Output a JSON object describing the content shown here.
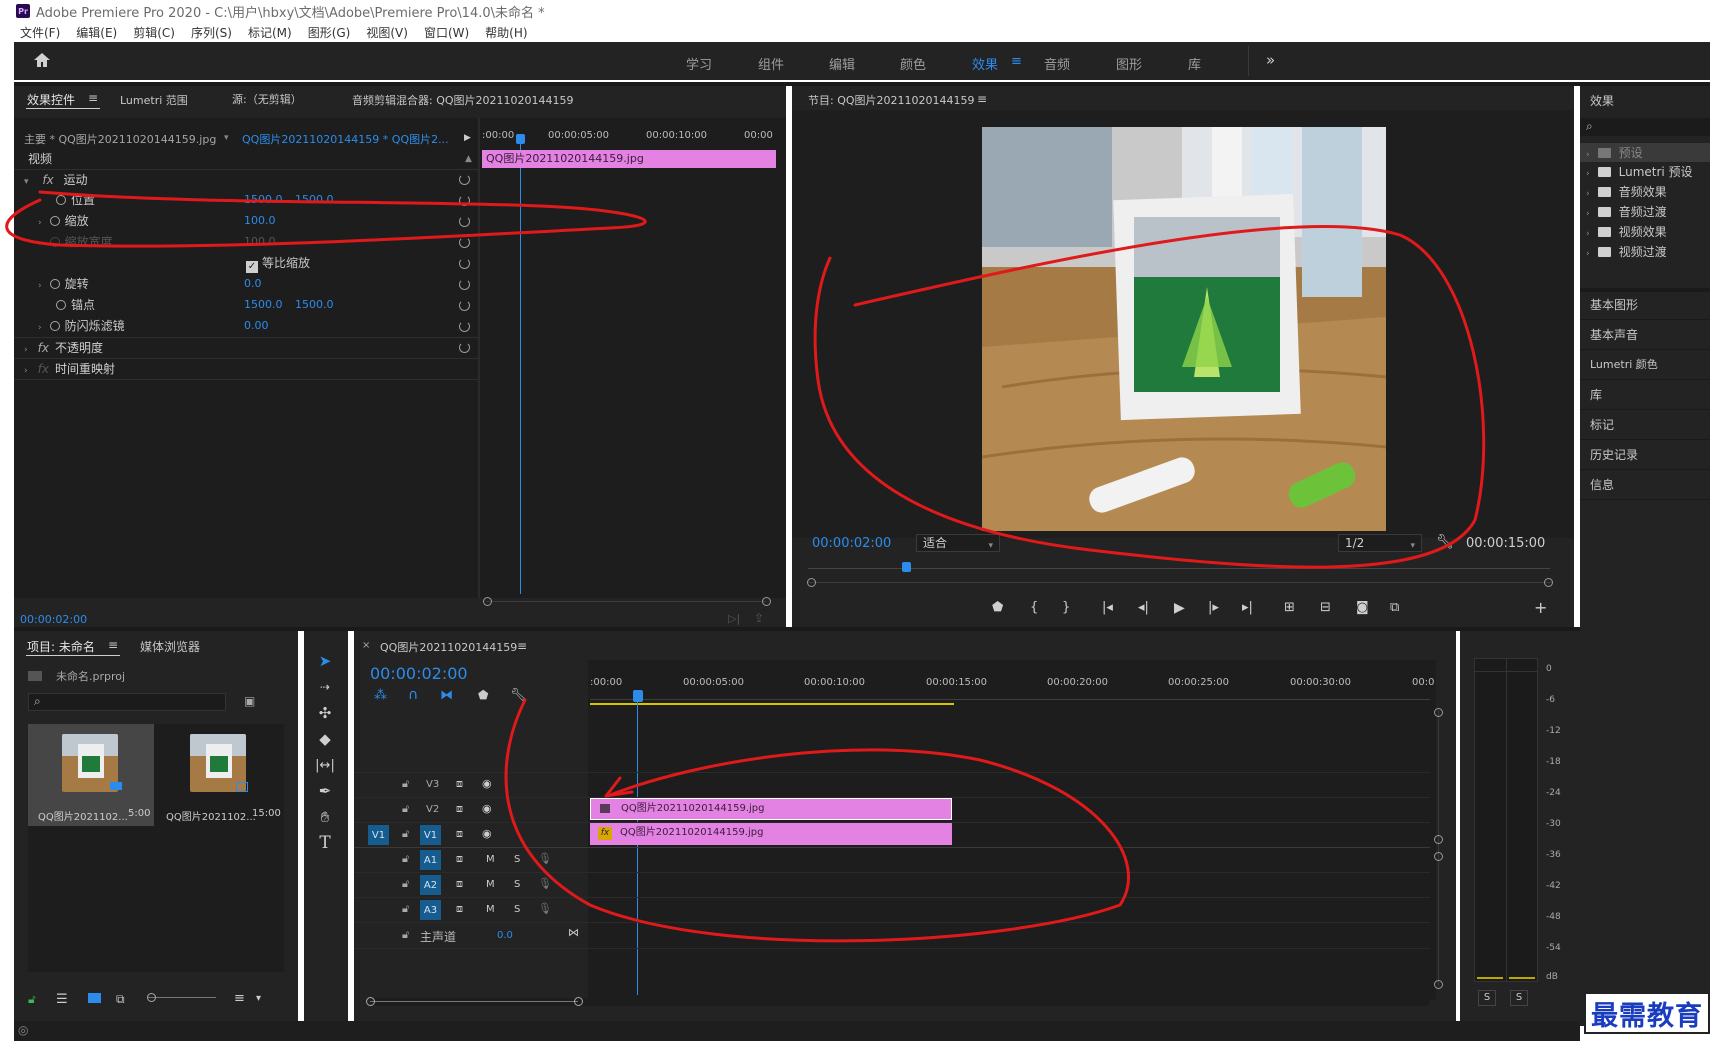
{
  "window": {
    "title": "Adobe Premiere Pro 2020 - C:\\用户\\hbxy\\文档\\Adobe\\Premiere Pro\\14.0\\未命名 *",
    "logo": "Pr"
  },
  "menu": [
    "文件(F)",
    "编辑(E)",
    "剪辑(C)",
    "序列(S)",
    "标记(M)",
    "图形(G)",
    "视图(V)",
    "窗口(W)",
    "帮助(H)"
  ],
  "workspaces": [
    "学习",
    "组件",
    "编辑",
    "颜色",
    "效果",
    "音频",
    "图形",
    "库"
  ],
  "workspace_more": "»",
  "effect_controls": {
    "tabs": [
      "效果控件",
      "Lumetri 范围",
      "源:（无剪辑）",
      "音频剪辑混合器: QQ图片20211020144159"
    ],
    "master_label": "主要 * QQ图片20211020144159.jpg",
    "clip_label": "QQ图片20211020144159 * QQ图片2...",
    "ruler": [
      ":00:00",
      "00:00:05:00",
      "00:00:10:00",
      "00:00"
    ],
    "clip_name": "QQ图片20211020144159.jpg",
    "section_video": "视频",
    "motion": "运动",
    "position": {
      "label": "位置",
      "x": "1500.0",
      "y": "1500.0"
    },
    "scale": {
      "label": "缩放",
      "value": "100.0"
    },
    "scale_width": {
      "label": "缩放宽度",
      "value": "100.0"
    },
    "uniform": "等比缩放",
    "rotation": {
      "label": "旋转",
      "value": "0.0"
    },
    "anchor": {
      "label": "锚点",
      "x": "1500.0",
      "y": "1500.0"
    },
    "antiflicker": {
      "label": "防闪烁滤镜",
      "value": "0.00"
    },
    "opacity": "不透明度",
    "time_remap": "时间重映射",
    "timecode": "00:00:02:00"
  },
  "program": {
    "title": "节目: QQ图片20211020144159",
    "timecode": "00:00:02:00",
    "fit": "适合",
    "resolution": "1/2",
    "duration": "00:00:15:00"
  },
  "effects_panel": {
    "title": "效果",
    "items": [
      "预设",
      "Lumetri 预设",
      "音频效果",
      "音频过渡",
      "视频效果",
      "视频过渡"
    ],
    "panels": [
      "基本图形",
      "基本声音",
      "Lumetri 颜色",
      "库",
      "标记",
      "历史记录",
      "信息"
    ]
  },
  "project": {
    "tabs": [
      "项目: 未命名",
      "媒体浏览器"
    ],
    "file": "未命名.prproj",
    "items": [
      {
        "name": "QQ图片2021102...",
        "duration": "5:00"
      },
      {
        "name": "QQ图片2021102...",
        "duration": "15:00"
      }
    ]
  },
  "timeline": {
    "title": "QQ图片20211020144159",
    "timecode": "00:00:02:00",
    "ruler": [
      ":00:00",
      "00:00:05:00",
      "00:00:10:00",
      "00:00:15:00",
      "00:00:20:00",
      "00:00:25:00",
      "00:00:30:00",
      "00:0"
    ],
    "tracks_video": [
      "V3",
      "V2",
      "V1"
    ],
    "tracks_audio": [
      "A1",
      "A2",
      "A3"
    ],
    "source_patch": "V1",
    "mute": "M",
    "solo": "S",
    "master": "主声道",
    "master_value": "0.0",
    "clip_v2": "QQ图片20211020144159.jpg",
    "clip_v1": "QQ图片20211020144159.jpg",
    "fx_badge": "fx"
  },
  "meter": {
    "labels": [
      "0",
      "-6",
      "-12",
      "-18",
      "-24",
      "-30",
      "-36",
      "-42",
      "-48",
      "-54",
      "dB"
    ],
    "solo": [
      "S",
      "S"
    ]
  },
  "watermark": "最需教育",
  "colors": {
    "accent": "#2d8ceb",
    "clip": "#e382e3",
    "annotation": "#e01a1a",
    "track_active": "#165c8f"
  }
}
